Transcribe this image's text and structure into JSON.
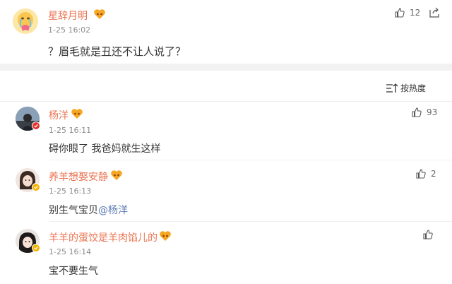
{
  "post": {
    "username": "星辞月明",
    "time": "1-25 16:02",
    "content": "？眉毛就是丑还不让人说了？",
    "likes": "12"
  },
  "sort": {
    "label": "按热度"
  },
  "comments": [
    {
      "username": "杨洋",
      "time": "1-25 16:11",
      "content": "碍你眼了 我爸妈就生这样",
      "likes": "93"
    },
    {
      "username": "养羊想娶安静",
      "time": "1-25 16:13",
      "content": "别生气宝贝",
      "mention": "@杨洋",
      "likes": "2"
    },
    {
      "username": "羊羊的蛋饺是羊肉馅儿的",
      "time": "1-25 16:14",
      "content": "宝不要生气",
      "likes": ""
    }
  ],
  "colors": {
    "username": "#eb7350",
    "mention": "#5b7ab5",
    "badge": "#f5a623",
    "text": "#333333",
    "muted": "#8c8c8c"
  },
  "icons": {
    "like": "thumbs-up-icon",
    "share": "share-icon",
    "sort": "sort-icon",
    "badge": "vip-heart-badge-icon"
  }
}
